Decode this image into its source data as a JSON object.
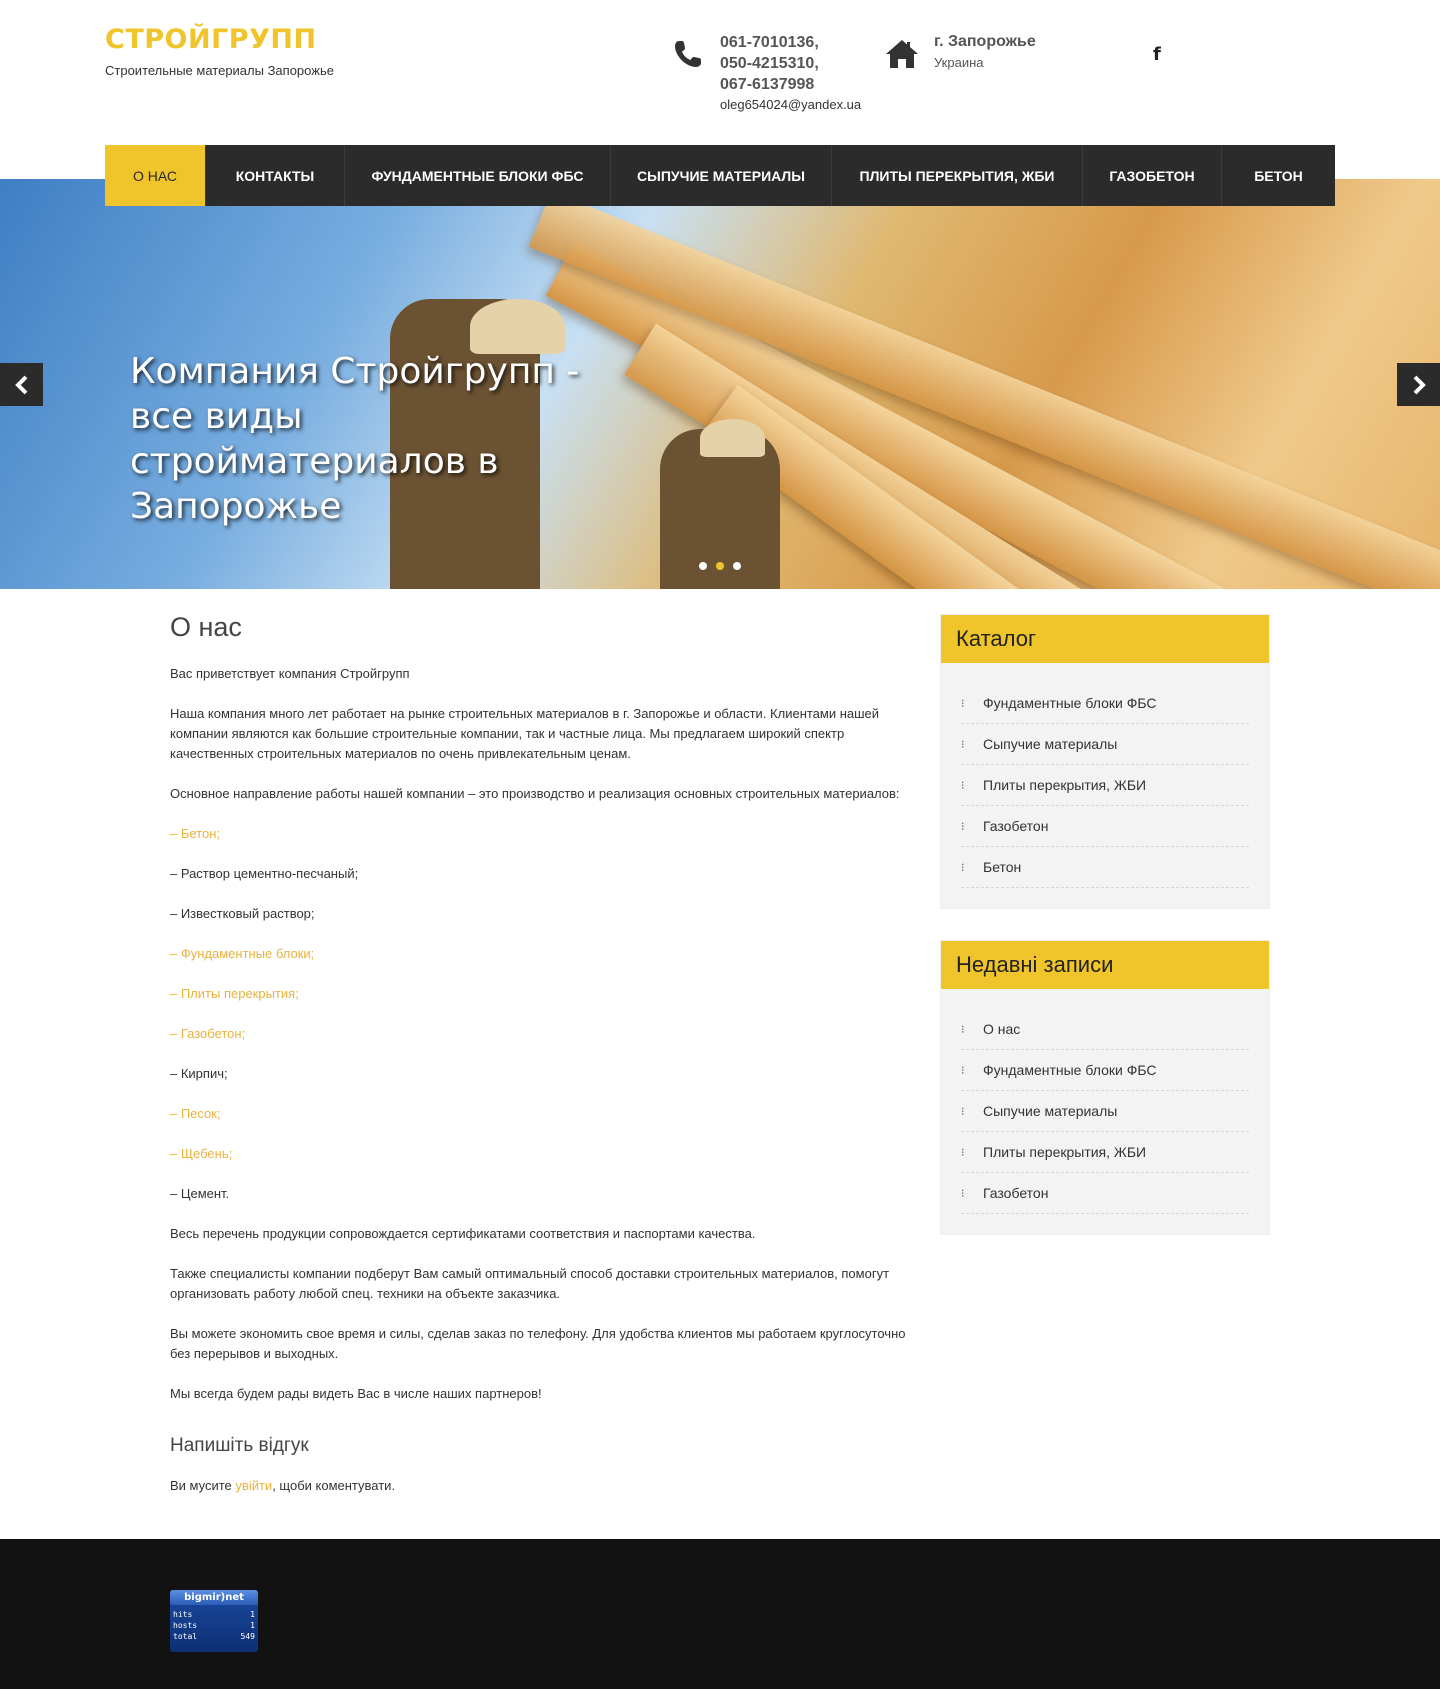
{
  "header": {
    "site_title": "СТРОЙГРУПП",
    "site_description": "Строительные материалы Запорожье",
    "phones": [
      "061-7010136,",
      "050-4215310,",
      "067-6137998"
    ],
    "email": "oleg654024@yandex.ua",
    "city": "г. Запорожье",
    "country": "Украина",
    "social_icon": "facebook-icon"
  },
  "nav": {
    "items": [
      {
        "label": "О НАС",
        "active": true
      },
      {
        "label": "КОНТАКТЫ"
      },
      {
        "label": "ФУНДАМЕНТНЫЕ БЛОКИ ФБС"
      },
      {
        "label": "СЫПУЧИЕ МАТЕРИАЛЫ"
      },
      {
        "label": "ПЛИТЫ ПЕРЕКРЫТИЯ, ЖБИ"
      },
      {
        "label": "ГАЗОБЕТОН"
      },
      {
        "label": "БЕТОН"
      }
    ]
  },
  "hero": {
    "caption": "Компания Стройгрупп - все виды стройматериалов в Запорожье",
    "prev_icon": "chevron-left-icon",
    "next_icon": "chevron-right-icon",
    "slides": 3,
    "active_slide": 2
  },
  "main": {
    "title": "О нас",
    "paragraphs": [
      "Вас приветствует компания Стройгрупп",
      "Наша компания много лет работает на рынке строительных материалов в г. Запорожье и области. Клиентами нашей компании являются как большие строительные компании, так и частные лица. Мы предлагаем широкий спектр качественных строительных материалов по очень привлекательным ценам.",
      "Основное направление работы нашей компании – это производство и реализация основных строительных материалов:"
    ],
    "materials": [
      {
        "text": "– Бетон;",
        "link": true
      },
      {
        "text": "– Раствор цементно-песчаный;",
        "link": false
      },
      {
        "text": "– Известковый раствор;",
        "link": false
      },
      {
        "text": "– Фундаментные блоки;",
        "link": true
      },
      {
        "text": "– Плиты перекрытия;",
        "link": true
      },
      {
        "text": "– Газобетон;",
        "link": true
      },
      {
        "text": "– Кирпич;",
        "link": false
      },
      {
        "text": "– Песок;",
        "link": true
      },
      {
        "text": "– Щебень;",
        "link": true
      },
      {
        "text": "– Цемент.",
        "link": false
      }
    ],
    "closing": [
      "Весь перечень продукции сопровождается сертификатами соответствия и паспортами качества.",
      "Также специалисты компании подберут Вам самый оптимальный способ доставки строительных материалов, помогут организовать работу любой спец. техники на объекте заказчика.",
      "Вы можете экономить свое время и силы, сделав заказ по телефону. Для удобства клиентов мы работаем круглосуточно без перерывов и выходных.",
      "Мы всегда будем рады видеть Вас в числе наших партнеров!"
    ],
    "reply_title": "Напишіть відгук",
    "reply_before": "Ви мусите ",
    "reply_link": "увійти",
    "reply_after": ", щоби коментувати."
  },
  "sidebar": {
    "catalog": {
      "title": "Каталог",
      "items": [
        "Фундаментные блоки ФБС",
        "Сыпучие материалы",
        "Плиты перекрытия, ЖБИ",
        "Газобетон",
        "Бетон"
      ]
    },
    "recent": {
      "title": "Недавні записи",
      "items": [
        "О нас",
        "Фундаментные блоки ФБС",
        "Сыпучие материалы",
        "Плиты перекрытия, ЖБИ",
        "Газобетон"
      ]
    }
  },
  "footer": {
    "counter": {
      "brand": "bigmir)net",
      "rows": [
        {
          "label": "hits",
          "value": "1"
        },
        {
          "label": "hosts",
          "value": "1"
        },
        {
          "label": "total",
          "value": "549"
        }
      ]
    }
  },
  "colors": {
    "accent": "#f0c42b",
    "nav_bg": "#2b2b2b",
    "link": "#e9b23c",
    "footer_bg": "#121212"
  }
}
